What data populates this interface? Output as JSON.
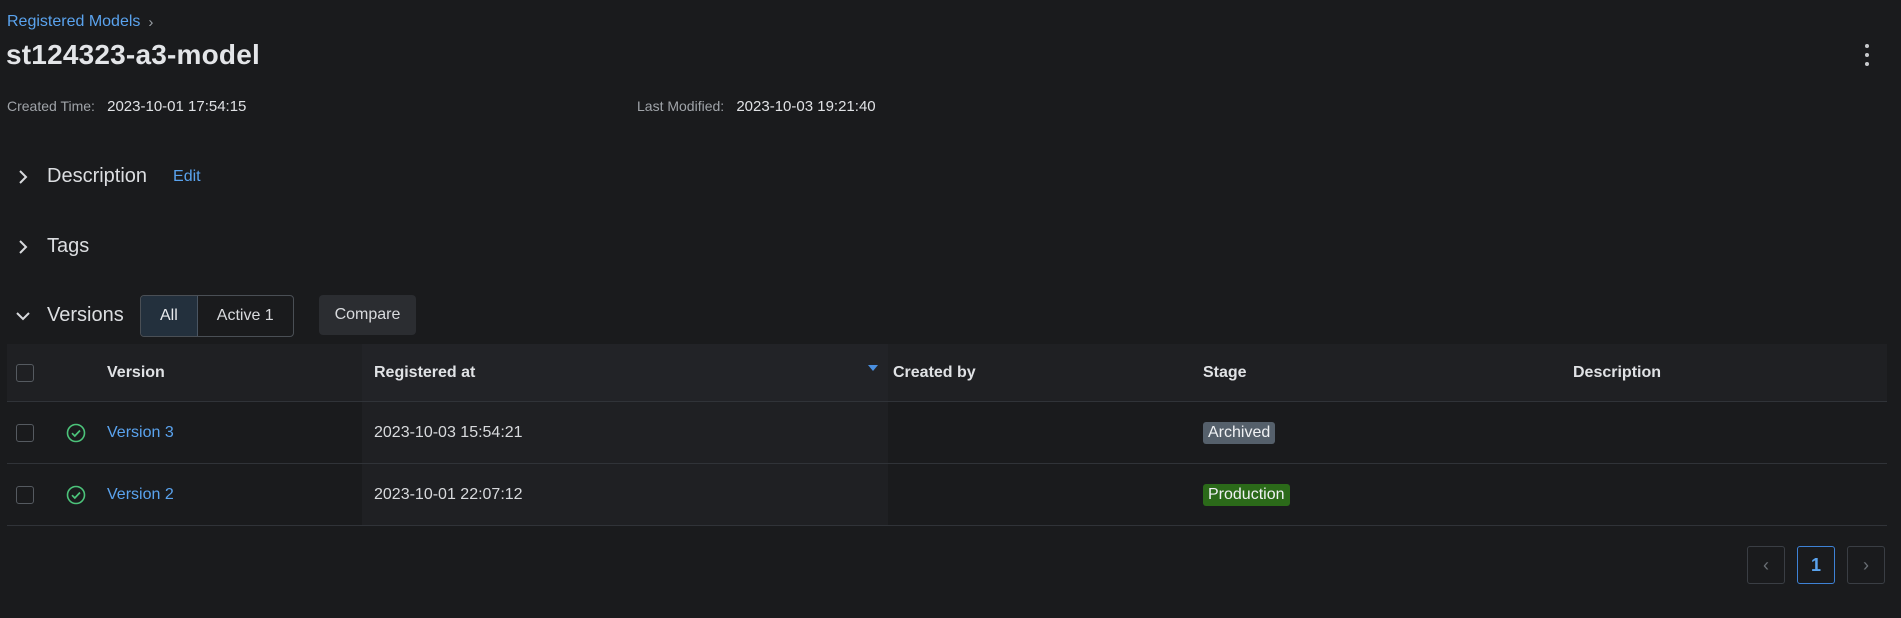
{
  "breadcrumb": {
    "parent": "Registered Models",
    "separator": "›"
  },
  "title": "st124323-a3-model",
  "meta": {
    "created_label": "Created Time:",
    "created_value": "2023-10-01 17:54:15",
    "modified_label": "Last Modified:",
    "modified_value": "2023-10-03 19:21:40"
  },
  "sections": {
    "description": "Description",
    "edit": "Edit",
    "tags": "Tags",
    "versions": "Versions"
  },
  "filters": {
    "all": "All",
    "active": "Active 1",
    "compare": "Compare"
  },
  "table": {
    "headers": {
      "version": "Version",
      "registered_at": "Registered at",
      "created_by": "Created by",
      "stage": "Stage",
      "description": "Description"
    },
    "rows": [
      {
        "version": "Version 3",
        "registered_at": "2023-10-03 15:54:21",
        "created_by": "",
        "stage": "Archived",
        "stage_color": "#55606b",
        "description": ""
      },
      {
        "version": "Version 2",
        "registered_at": "2023-10-01 22:07:12",
        "created_by": "",
        "stage": "Production",
        "stage_color": "#2b6a19",
        "description": ""
      }
    ]
  },
  "pagination": {
    "current_page": "1",
    "prev": "‹",
    "next": "›"
  },
  "colors": {
    "accent": "#5aa3ee",
    "background": "#1a1b1d"
  }
}
